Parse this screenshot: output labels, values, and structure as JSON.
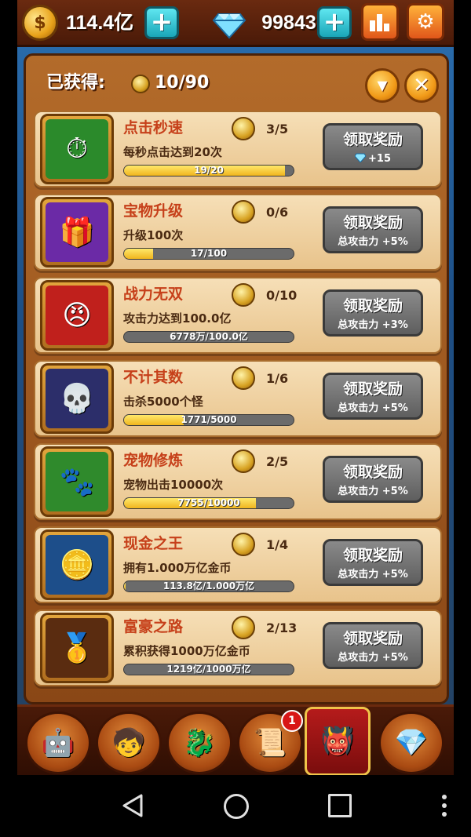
{
  "topbar": {
    "money": "114.4亿",
    "gems": "99843",
    "icons": [
      "coin-icon",
      "plus-icon",
      "diamond-icon",
      "plus-icon",
      "leaderboard-icon",
      "gear-icon"
    ]
  },
  "panel": {
    "obtained_label": "已获得:",
    "obtained_count": "10/90",
    "buttons": [
      "chevron-down-icon",
      "close-icon"
    ]
  },
  "achievements": [
    {
      "title": "点击秒速",
      "progress": "3/5",
      "desc": "每秒点击达到20次",
      "bar_text": "19/20",
      "fill": 0.95,
      "claim": "领取奖励",
      "reward": "+15",
      "reward_icon": "diamond-icon",
      "thumb_icon": "stopwatch-icon",
      "thumb_color": "#2b8a2b"
    },
    {
      "title": "宝物升级",
      "progress": "0/6",
      "desc": "升级100次",
      "bar_text": "17/100",
      "fill": 0.17,
      "claim": "领取奖励",
      "reward": "总攻击力 +5%",
      "reward_icon": "",
      "thumb_icon": "treasure-chest-icon",
      "thumb_color": "#6b2aa6"
    },
    {
      "title": "战力无双",
      "progress": "0/10",
      "desc": "攻击力达到100.0亿",
      "bar_text": "6778万/100.0亿",
      "fill": 0.0,
      "claim": "领取奖励",
      "reward": "总攻击力 +3%",
      "reward_icon": "",
      "thumb_icon": "warrior-icon",
      "thumb_color": "#c0201c"
    },
    {
      "title": "不计其数",
      "progress": "1/6",
      "desc": "击杀5000个怪",
      "bar_text": "1771/5000",
      "fill": 0.35,
      "claim": "领取奖励",
      "reward": "总攻击力 +5%",
      "reward_icon": "",
      "thumb_icon": "graveyard-icon",
      "thumb_color": "#2c2e6a"
    },
    {
      "title": "宠物修炼",
      "progress": "2/5",
      "desc": "宠物出击10000次",
      "bar_text": "7755/10000",
      "fill": 0.78,
      "claim": "领取奖励",
      "reward": "总攻击力 +5%",
      "reward_icon": "",
      "thumb_icon": "pet-icon",
      "thumb_color": "#2f8a2c"
    },
    {
      "title": "现金之王",
      "progress": "1/4",
      "desc": "拥有1.000万亿金币",
      "bar_text": "113.8亿/1.000万亿",
      "fill": 0.01,
      "claim": "领取奖励",
      "reward": "总攻击力 +5%",
      "reward_icon": "",
      "thumb_icon": "coin-stack-icon",
      "thumb_color": "#1d4e8a"
    },
    {
      "title": "富豪之路",
      "progress": "2/13",
      "desc": "累积获得1000万亿金币",
      "bar_text": "1219亿/1000万亿",
      "fill": 0.0,
      "claim": "领取奖励",
      "reward": "总攻击力 +5%",
      "reward_icon": "",
      "thumb_icon": "gold-bars-icon",
      "thumb_color": "#5a2c10"
    }
  ],
  "bottom_nav": {
    "items": [
      {
        "icon": "hero-robot-icon"
      },
      {
        "icon": "hero-face-icon"
      },
      {
        "icon": "dragon-emblem-icon"
      },
      {
        "icon": "scroll-icon"
      },
      {
        "icon": "demon-banner-icon"
      },
      {
        "icon": "winged-diamond-icon"
      }
    ],
    "badge": "1"
  },
  "system_nav": {
    "icons": [
      "back-icon",
      "home-icon",
      "recents-icon",
      "more-icon"
    ]
  },
  "colors": {
    "title_red": "#c6401a",
    "claim_gray": "#5e5e5e",
    "progress_fill": "#f0b51e"
  }
}
